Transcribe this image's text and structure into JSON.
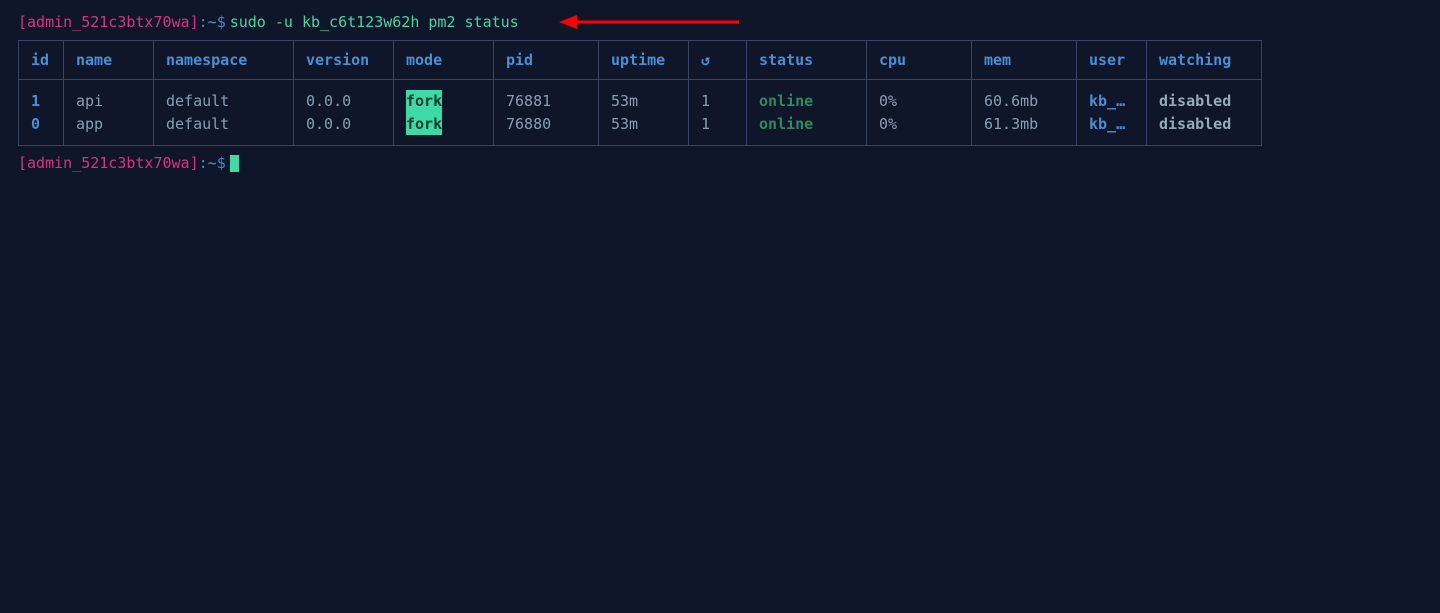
{
  "prompt": {
    "user": "admin_521c3btx70wa",
    "path": "~",
    "symbol": "$",
    "command": "sudo -u kb_c6t123w62h pm2 status"
  },
  "table": {
    "headers": {
      "id": "id",
      "name": "name",
      "namespace": "namespace",
      "version": "version",
      "mode": "mode",
      "pid": "pid",
      "uptime": "uptime",
      "restart": "↺",
      "status": "status",
      "cpu": "cpu",
      "mem": "mem",
      "user": "user",
      "watching": "watching"
    },
    "rows": [
      {
        "id": "1",
        "name": "api",
        "namespace": "default",
        "version": "0.0.0",
        "mode": "fork",
        "pid": "76881",
        "uptime": "53m",
        "restart": "1",
        "status": "online",
        "cpu": "0%",
        "mem": "60.6mb",
        "user": "kb_…",
        "watching": "disabled"
      },
      {
        "id": "0",
        "name": "app",
        "namespace": "default",
        "version": "0.0.0",
        "mode": "fork",
        "pid": "76880",
        "uptime": "53m",
        "restart": "1",
        "status": "online",
        "cpu": "0%",
        "mem": "61.3mb",
        "user": "kb_…",
        "watching": "disabled"
      }
    ]
  },
  "annotation": {
    "arrow_color": "#ff0000"
  }
}
